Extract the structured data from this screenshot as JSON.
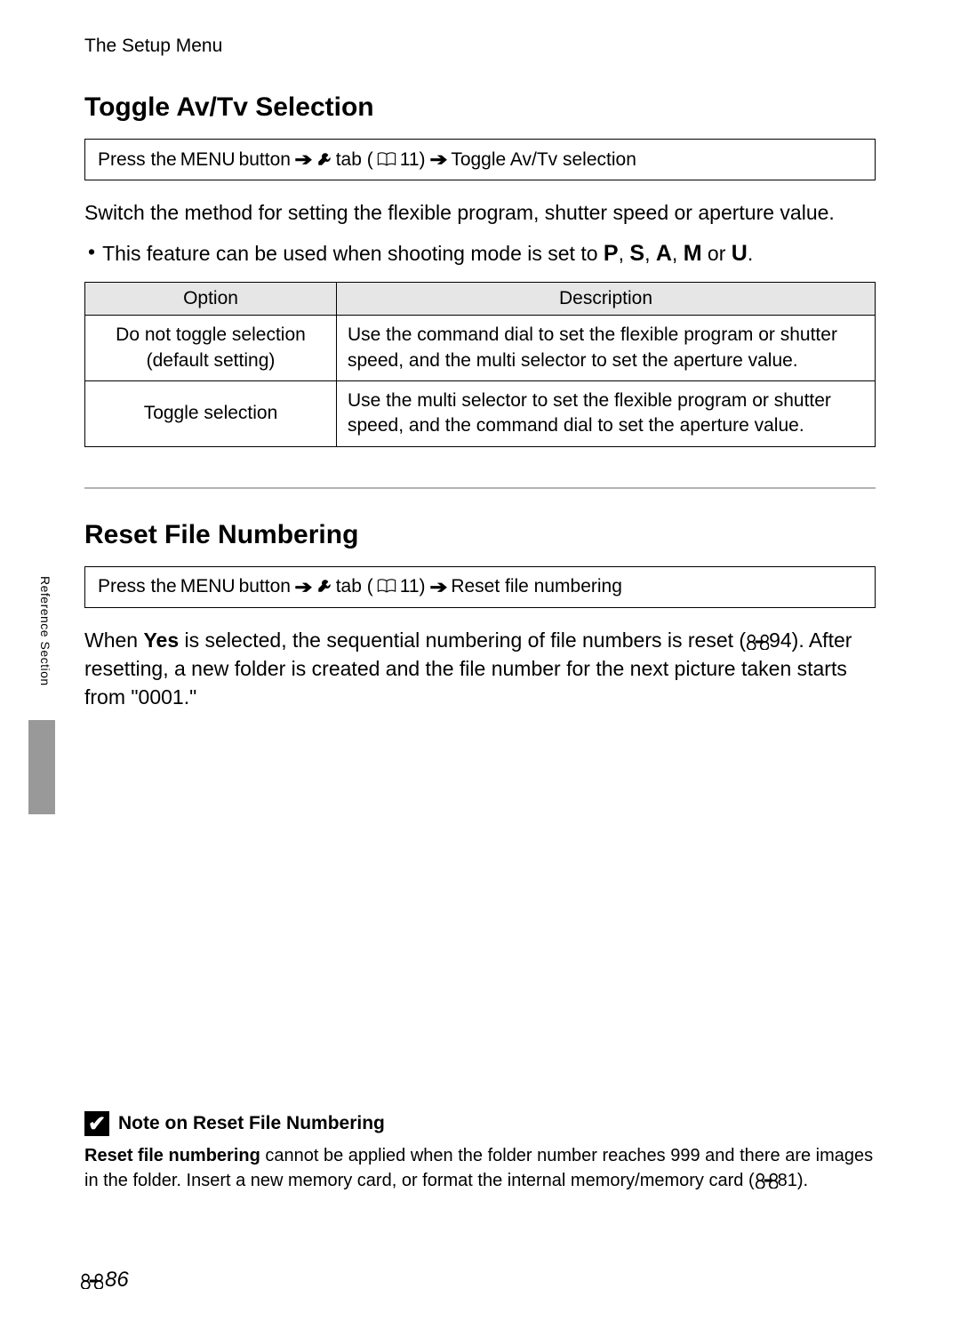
{
  "header": {
    "title": "The Setup Menu"
  },
  "side_tab": {
    "label": "Reference Section"
  },
  "section1": {
    "title": "Toggle Av/Tv Selection",
    "nav": {
      "prefix": "Press the ",
      "menu_word": "MENU",
      "after_menu": " button ",
      "tab_word": " tab (",
      "page_ref": "11) ",
      "dest": " Toggle Av/Tv selection"
    },
    "body": "Switch the method for setting the flexible program, shutter speed or aperture value.",
    "bullet_pre": "This feature can be used when shooting mode is set to ",
    "modes": {
      "p": "P",
      "s": "S",
      "a": "A",
      "m": "M",
      "u": "U"
    },
    "mode_seps": {
      "c1": ", ",
      "c2": ", ",
      "c3": ", ",
      "or": " or ",
      "dot": "."
    },
    "table": {
      "head": {
        "c1": "Option",
        "c2": "Description"
      },
      "row1": {
        "c1a": "Do not toggle selection",
        "c1b": "(default setting)",
        "c2": "Use the command dial to set the flexible program or shutter speed, and the multi selector to set the aperture value."
      },
      "row2": {
        "c1": "Toggle selection",
        "c2": "Use the multi selector to set the flexible program or shutter speed, and the command dial to set the aperture value."
      }
    }
  },
  "section2": {
    "title": "Reset File Numbering",
    "nav": {
      "prefix": "Press the ",
      "menu_word": "MENU",
      "after_menu": " button ",
      "tab_word": " tab (",
      "page_ref": "11) ",
      "dest": " Reset file numbering"
    },
    "body": {
      "pre": "When ",
      "yes": "Yes",
      "mid": " is selected, the sequential numbering of file numbers is reset (",
      "ref": "94). After resetting, a new folder is created and  the file number for the next picture taken starts from \"0001.\""
    }
  },
  "note": {
    "heading": "Note on Reset File Numbering",
    "body_bold": "Reset file numbering",
    "body_rest": " cannot be applied when the folder number reaches 999 and there are images in the folder. Insert a new memory card, or format the internal memory/memory card (",
    "body_ref": "81)."
  },
  "page_number": "86"
}
